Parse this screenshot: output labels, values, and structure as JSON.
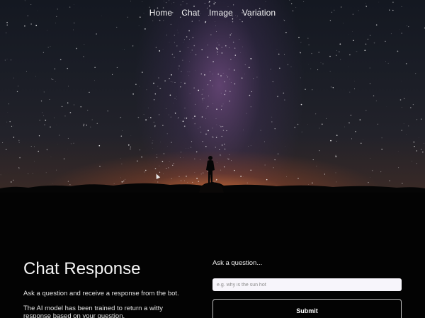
{
  "nav": {
    "items": [
      {
        "label": "Home"
      },
      {
        "label": "Chat"
      },
      {
        "label": "Image"
      },
      {
        "label": "Variation"
      }
    ]
  },
  "hero": {
    "image": "night-sky-milky-way-person-silhouette"
  },
  "main": {
    "title": "Chat Response",
    "description_1": "Ask a question and receive a response from the bot.",
    "description_2": "The AI model has been trained to return a witty response based on your question."
  },
  "form": {
    "label": "Ask a question...",
    "input_placeholder": "e.g. why is the sun hot",
    "input_value": "",
    "submit_label": "Submit"
  },
  "colors": {
    "background": "#030303",
    "text": "#f4f4f4",
    "input_bg": "#f7f5fb",
    "button_border": "#bdbdbd"
  }
}
